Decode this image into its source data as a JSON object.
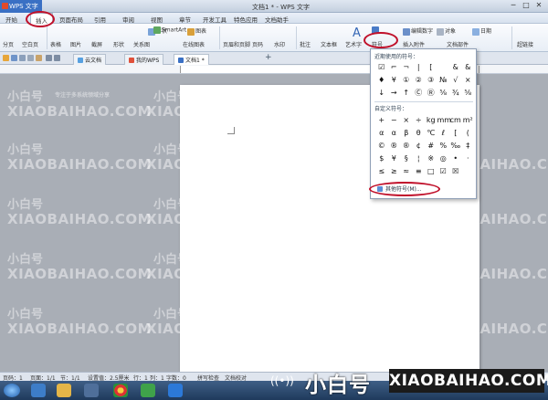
{
  "window": {
    "app_button": "WPS 文字",
    "title": "文档1 * - WPS 文字",
    "controls": [
      "─",
      "□",
      "✕"
    ]
  },
  "menu": {
    "tabs": [
      "开始",
      "插入",
      "页面布局",
      "引用",
      "审阅",
      "视图",
      "章节",
      "开发工具",
      "特色应用",
      "文档助手"
    ],
    "active": "插入"
  },
  "ribbon": {
    "row1": [
      "形状",
      "SmartArt",
      "图表",
      "编辑数字",
      "对象",
      "日期"
    ],
    "row2": [
      "分页",
      "空白页",
      "表格",
      "图片",
      "截屏",
      "形状",
      "关系图",
      "在线图表",
      "页眉和页脚",
      "页码",
      "水印",
      "批注",
      "文本框",
      "艺术字",
      "符号",
      "插入附件",
      "文档部件",
      "超链接"
    ]
  },
  "doc_tabs": [
    "云文档",
    "我的WPS",
    "文档1 *"
  ],
  "symbol_popup": {
    "recent_label": "近期使用的符号：",
    "recent_symbols": [
      "☑",
      "⌐",
      "¬",
      "|",
      "[",
      "",
      "&",
      "&",
      "♦",
      "¥",
      "①",
      "②",
      "③",
      "№",
      "√",
      "×",
      "↓",
      "→",
      "↑",
      "Ⓒ",
      "Ⓡ",
      "⅝",
      "¾",
      "⅝"
    ],
    "custom_label": "自定义符号：",
    "custom_symbols": [
      "+",
      "−",
      "×",
      "÷",
      "kg",
      "mm",
      "cm",
      "m²",
      "α",
      "α",
      "β",
      "θ",
      "℃",
      "ℓ",
      "[",
      "(",
      "©",
      "®",
      "®",
      "¢",
      "#",
      "%",
      "‰",
      "‡",
      "$",
      "¥",
      "§",
      "¦",
      "※",
      "◎",
      "•",
      "·",
      "≤",
      "≥",
      "≈",
      "≡",
      "□",
      "☑",
      "☒",
      ""
    ],
    "more_label": "其他符号(M)..."
  },
  "status": {
    "page": "页码：1",
    "pages": "页面：1/1",
    "section": "节：1/1",
    "setting": "设置值：2.5厘米",
    "row": "行：1",
    "col": "列：1",
    "words": "字数：0",
    "spell": "拼写检查",
    "proof": "文档校对"
  },
  "watermark": {
    "brand_cn": "小白号",
    "brand_en": "XIAOBAIHAO.COM",
    "tagline": "专注于多系统领域分享"
  },
  "colors": {
    "accent": "#3a70c4",
    "highlight_ring": "#c0102a"
  }
}
